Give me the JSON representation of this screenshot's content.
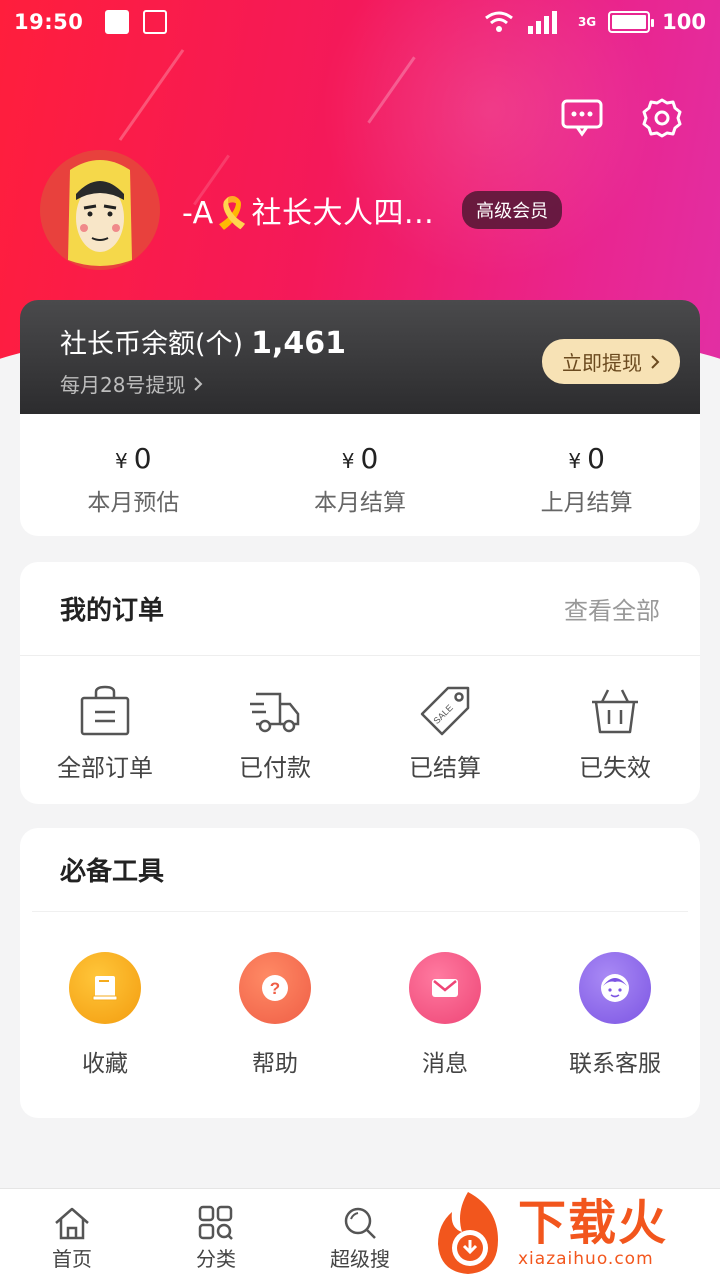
{
  "status_bar": {
    "time": "19:50",
    "network": "3G",
    "battery": "100"
  },
  "header": {
    "nickname": "-A🎗️社长大人四...",
    "member_badge": "高级会员"
  },
  "balance": {
    "label": "社长币余额(个)",
    "value": "1,461",
    "sub_prefix": "每月",
    "sub_day": "28",
    "sub_suffix": "号提现",
    "withdraw_label": "立即提现"
  },
  "earnings": [
    {
      "currency": "¥",
      "value": "0",
      "label": "本月预估"
    },
    {
      "currency": "¥",
      "value": "0",
      "label": "本月结算"
    },
    {
      "currency": "¥",
      "value": "0",
      "label": "上月结算"
    }
  ],
  "orders": {
    "title": "我的订单",
    "view_all": "查看全部",
    "items": [
      {
        "label": "全部订单",
        "icon": "bag-icon"
      },
      {
        "label": "已付款",
        "icon": "truck-icon"
      },
      {
        "label": "已结算",
        "icon": "sale-tag-icon"
      },
      {
        "label": "已失效",
        "icon": "basket-icon"
      }
    ]
  },
  "tools": {
    "title": "必备工具",
    "items": [
      {
        "label": "收藏",
        "icon": "book-icon",
        "color": "#f6a313"
      },
      {
        "label": "帮助",
        "icon": "question-icon",
        "color": "#f26a4f"
      },
      {
        "label": "消息",
        "icon": "mail-icon",
        "color": "#f04e7b"
      },
      {
        "label": "联系客服",
        "icon": "service-icon",
        "color": "#8c62e8"
      }
    ]
  },
  "tabbar": [
    {
      "label": "首页",
      "icon": "home-icon"
    },
    {
      "label": "分类",
      "icon": "category-icon"
    },
    {
      "label": "超级搜",
      "icon": "search-icon"
    }
  ],
  "watermark": {
    "title": "下载火",
    "domain": "xiazaihuo.com"
  },
  "colors": {
    "brand_red": "#ff1e3c",
    "brand_pink": "#e22fa4",
    "gold": "#f7e2b5"
  }
}
